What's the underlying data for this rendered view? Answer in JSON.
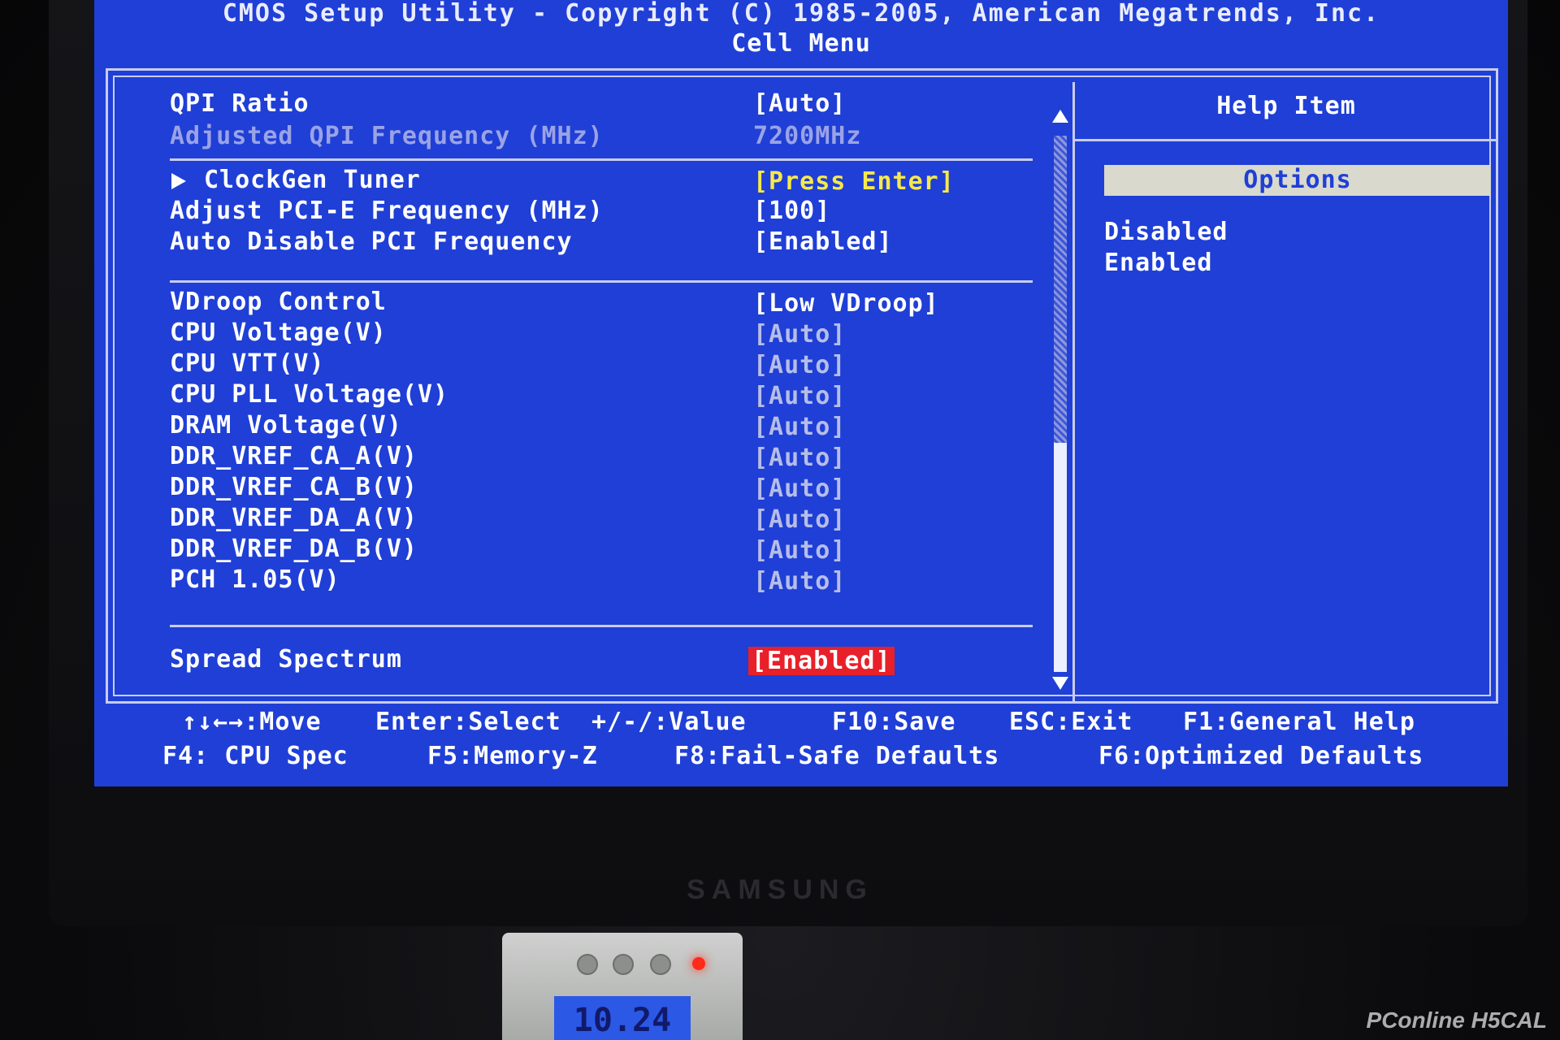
{
  "header": {
    "title": "CMOS Setup Utility - Copyright (C) 1985-2005, American Megatrends, Inc.",
    "menu_name": "Cell Menu"
  },
  "settings": [
    {
      "label": "QPI Ratio",
      "value": "[Auto]"
    },
    {
      "label": "Adjusted QPI Frequency (MHz)",
      "value": "7200MHz"
    },
    {
      "label": "ClockGen Tuner",
      "value": "[Press Enter]"
    },
    {
      "label": "Adjust PCI-E Frequency (MHz)",
      "value": "[100]"
    },
    {
      "label": "Auto Disable PCI Frequency",
      "value": "[Enabled]"
    },
    {
      "label": "VDroop Control",
      "value": "[Low VDroop]"
    },
    {
      "label": "CPU Voltage(V)",
      "value": "[Auto]"
    },
    {
      "label": "CPU VTT(V)",
      "value": "[Auto]"
    },
    {
      "label": "CPU PLL Voltage(V)",
      "value": "[Auto]"
    },
    {
      "label": "DRAM Voltage(V)",
      "value": "[Auto]"
    },
    {
      "label": "DDR_VREF_CA_A(V)",
      "value": "[Auto]"
    },
    {
      "label": "DDR_VREF_CA_B(V)",
      "value": "[Auto]"
    },
    {
      "label": "DDR_VREF_DA_A(V)",
      "value": "[Auto]"
    },
    {
      "label": "DDR_VREF_DA_B(V)",
      "value": "[Auto]"
    },
    {
      "label": "PCH 1.05(V)",
      "value": "[Auto]"
    },
    {
      "label": "Spread Spectrum",
      "value": "[Enabled]"
    }
  ],
  "help": {
    "title": "Help Item",
    "options_label": "Options",
    "options": [
      "Disabled",
      "Enabled"
    ]
  },
  "keys": {
    "move": "↑↓←→:Move",
    "select": "Enter:Select",
    "value": "+/-/:Value",
    "save": "F10:Save",
    "exit": "ESC:Exit",
    "general_help": "F1:General Help",
    "cpu_spec": "F4: CPU Spec",
    "memory_z": "F5:Memory-Z",
    "failsafe": "F8:Fail-Safe Defaults",
    "optimized": "F6:Optimized Defaults"
  },
  "monitor_brand": "SAMSUNG",
  "meter_reading": "10.24",
  "watermark": "PConline H5CAL",
  "colors": {
    "bios_background": "#1f3fd6",
    "selected_value": "#e8202a",
    "submenu_value": "#f6e94a"
  }
}
